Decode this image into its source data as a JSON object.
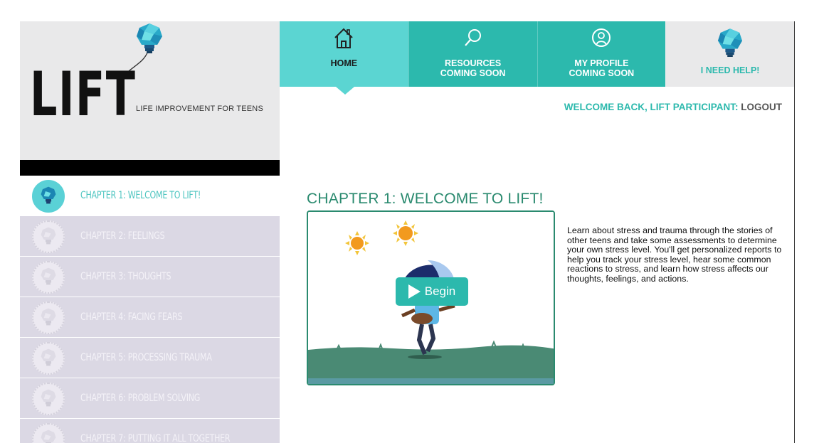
{
  "logo": {
    "wordmark": "LIFT",
    "tagline": "LIFE IMPROVEMENT FOR TEENS"
  },
  "nav": {
    "items": [
      {
        "line1": "HOME",
        "line2": "",
        "icon": "home-icon"
      },
      {
        "line1": "RESOURCES",
        "line2": "COMING SOON",
        "icon": "search-icon"
      },
      {
        "line1": "MY PROFILE",
        "line2": "COMING SOON",
        "icon": "profile-icon"
      },
      {
        "line1": "I NEED HELP!",
        "line2": "",
        "icon": "lightbulb-icon"
      }
    ]
  },
  "header": {
    "welcome": "WELCOME BACK, LIFT PARTICIPANT:",
    "logout": "LOGOUT"
  },
  "sidebar": {
    "chapters": [
      {
        "label": "CHAPTER 1: WELCOME TO LIFT!",
        "active": true
      },
      {
        "label": "CHAPTER 2: FEELINGS",
        "active": false
      },
      {
        "label": "CHAPTER 3: THOUGHTS",
        "active": false
      },
      {
        "label": "CHAPTER 4: FACING FEARS",
        "active": false
      },
      {
        "label": "CHAPTER 5: PROCESSING TRAUMA",
        "active": false
      },
      {
        "label": "CHAPTER 6: PROBLEM SOLVING",
        "active": false
      },
      {
        "label": "CHAPTER 7: PUTTING IT ALL TOGETHER",
        "active": false
      }
    ]
  },
  "main": {
    "title": "CHAPTER 1: WELCOME TO LIFT!",
    "begin_label": "Begin",
    "description": "Learn about stress and trauma through the stories of other teens and take some assessments to determine your own stress level. You'll get personalized reports to help you track your stress level, hear some common reactions to stress, and learn how stress affects our thoughts, feelings, and actions."
  },
  "colors": {
    "accent": "#2cb9ad",
    "accent_light": "#5bd5d2",
    "title_green": "#2a8a6f",
    "sidebar_inactive": "#dbd8e4"
  }
}
